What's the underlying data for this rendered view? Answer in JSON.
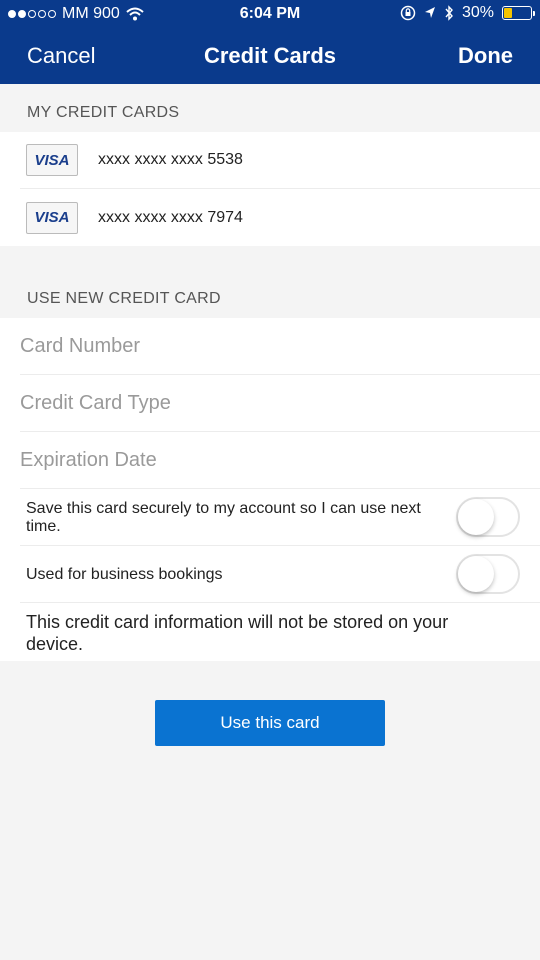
{
  "status_bar": {
    "carrier": "MM 900",
    "signal_bars_filled": 2,
    "signal_bars_total": 5,
    "time": "6:04 PM",
    "battery_percent": "30%",
    "battery_level": 0.3,
    "icons": [
      "wifi-icon",
      "rotation-lock-icon",
      "location-icon",
      "bluetooth-icon",
      "battery-icon"
    ]
  },
  "nav": {
    "cancel_label": "Cancel",
    "title": "Credit Cards",
    "done_label": "Done"
  },
  "my_cards": {
    "header": "MY CREDIT CARDS",
    "cards": [
      {
        "brand": "VISA",
        "number": "xxxx xxxx xxxx 5538"
      },
      {
        "brand": "VISA",
        "number": "xxxx xxxx xxxx 7974"
      }
    ]
  },
  "new_card": {
    "header": "USE NEW CREDIT CARD",
    "card_number_placeholder": "Card Number",
    "card_type_placeholder": "Credit Card Type",
    "expiration_placeholder": "Expiration Date",
    "save_card_label": "Save this card securely to my account so I can use next time.",
    "save_card_on": false,
    "business_label": "Used for business bookings",
    "business_on": false,
    "notice": "This credit card information will not be stored on your device."
  },
  "actions": {
    "use_card_label": "Use this card"
  },
  "colors": {
    "nav_background": "#0a3a8c",
    "button_background": "#0a73d1",
    "battery_fill": "#f5c400",
    "page_background": "#f4f4f4"
  }
}
